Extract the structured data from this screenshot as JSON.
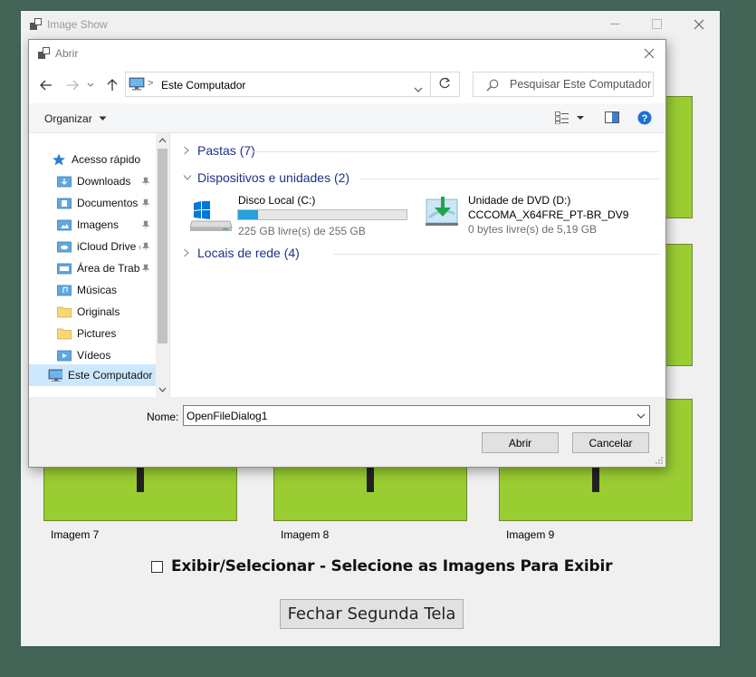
{
  "main_window": {
    "title": "Image Show",
    "tiles": [
      {
        "label": "Imagem 7"
      },
      {
        "label": "Imagem 8"
      },
      {
        "label": "Imagem 9"
      }
    ],
    "checkbox_label": "Exibir/Selecionar - Selecione as Imagens Para Exibir",
    "close_button_label": "Fechar Segunda Tela"
  },
  "dialog": {
    "title": "Abrir",
    "address": {
      "location": "Este Computador",
      "separator": ">"
    },
    "search_placeholder": "Pesquisar Este Computador",
    "toolbar": {
      "organize_label": "Organizar"
    },
    "nav_items": [
      {
        "label": "Acesso rápido",
        "icon": "star-icon"
      },
      {
        "label": "Downloads",
        "icon": "folder-download-icon",
        "pinned": true
      },
      {
        "label": "Documentos",
        "icon": "folder-documents-icon",
        "pinned": true
      },
      {
        "label": "Imagens",
        "icon": "folder-images-icon",
        "pinned": true
      },
      {
        "label": "iCloud Drive (",
        "icon": "folder-icloud-icon",
        "pinned": true
      },
      {
        "label": "Área de Traba",
        "icon": "folder-desktop-icon",
        "pinned": true
      },
      {
        "label": "Músicas",
        "icon": "folder-music-icon"
      },
      {
        "label": "Originals",
        "icon": "folder-yellow-icon"
      },
      {
        "label": "Pictures",
        "icon": "folder-yellow-icon"
      },
      {
        "label": "Vídeos",
        "icon": "folder-videos-icon"
      },
      {
        "label": "Este Computador",
        "icon": "computer-icon",
        "selected": true
      }
    ],
    "groups": {
      "folders": "Pastas (7)",
      "devices": "Dispositivos e unidades (2)",
      "network": "Locais de rede (4)"
    },
    "drives": [
      {
        "name": "Disco Local (C:)",
        "free_text": "225 GB livre(s) de 255 GB",
        "used_fraction": 0.118
      },
      {
        "name": "Unidade de DVD (D:)",
        "subtitle": "CCCOMA_X64FRE_PT-BR_DV9",
        "free_text": "0 bytes livre(s) de 5,19 GB"
      }
    ],
    "filename_label": "Nome:",
    "filename_value": "OpenFileDialog1",
    "open_button": "Abrir",
    "cancel_button": "Cancelar"
  },
  "colors": {
    "desktop": "#436457",
    "tile_green": "#9acd32",
    "accent_blue": "#1e3287",
    "progress_blue": "#26a0da"
  }
}
